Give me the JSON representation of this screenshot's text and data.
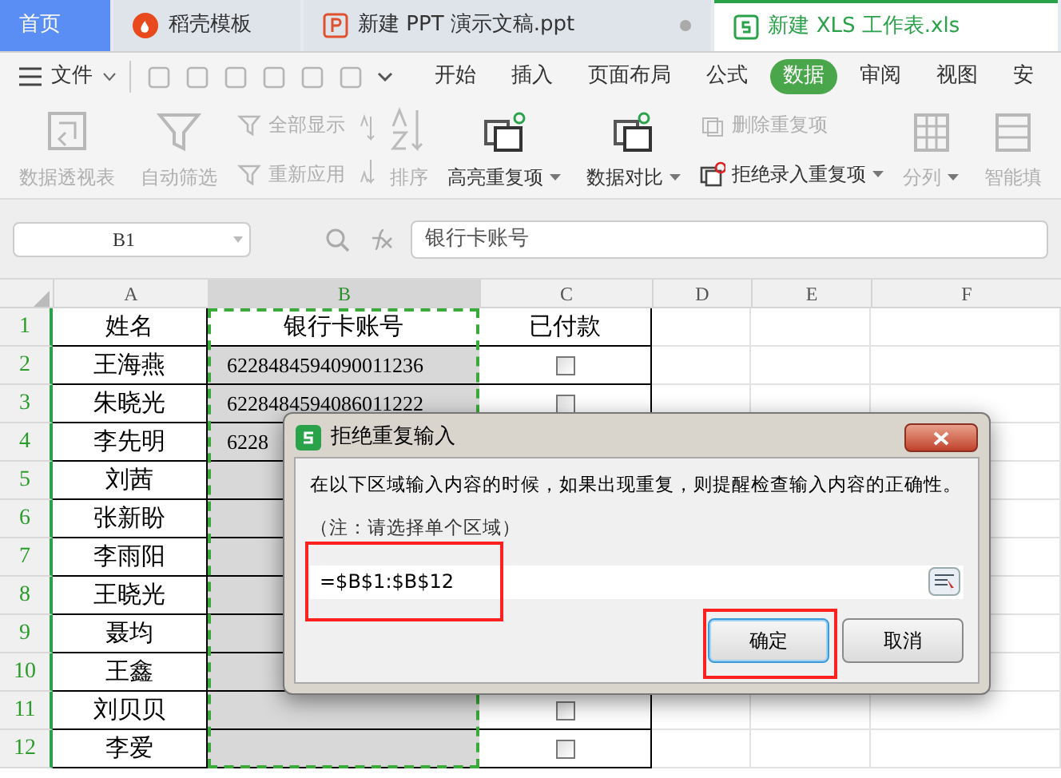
{
  "tabs": [
    {
      "kind": "home",
      "label": "首页",
      "selected": false
    },
    {
      "kind": "template",
      "label": "稻壳模板",
      "selected": false
    },
    {
      "kind": "ppt",
      "label": "新建 PPT 演示文稿.ppt",
      "selected": false
    },
    {
      "kind": "xls",
      "label": "新建 XLS 工作表.xls",
      "selected": true
    }
  ],
  "menu": {
    "file": "文件",
    "tabs": [
      {
        "label": "开始",
        "selected": false
      },
      {
        "label": "插入",
        "selected": false
      },
      {
        "label": "页面布局",
        "selected": false
      },
      {
        "label": "公式",
        "selected": false
      },
      {
        "label": "数据",
        "selected": true
      },
      {
        "label": "审阅",
        "selected": false
      },
      {
        "label": "视图",
        "selected": false
      },
      {
        "label": "安",
        "selected": false
      }
    ]
  },
  "ribbon": [
    {
      "kind": "big",
      "label": "数据透视表",
      "disabled": true,
      "dropdown": false
    },
    {
      "kind": "big",
      "label": "自动筛选",
      "disabled": true,
      "dropdown": false
    },
    {
      "kind": "stack",
      "items": [
        {
          "label": "全部显示",
          "disabled": true,
          "dropdown": false
        },
        {
          "label": "重新应用",
          "disabled": true,
          "dropdown": false
        }
      ]
    },
    {
      "kind": "sort",
      "label": "排序",
      "disabled": true
    },
    {
      "kind": "big",
      "label": "高亮重复项",
      "disabled": false,
      "dropdown": true
    },
    {
      "kind": "big",
      "label": "数据对比",
      "disabled": false,
      "dropdown": true
    },
    {
      "kind": "stack",
      "items": [
        {
          "label": "删除重复项",
          "disabled": true,
          "dropdown": false
        },
        {
          "label": "拒绝录入重复项",
          "disabled": false,
          "dropdown": true
        }
      ]
    },
    {
      "kind": "big",
      "label": "分列",
      "disabled": true,
      "dropdown": true
    },
    {
      "kind": "big",
      "label": "智能填",
      "disabled": true,
      "dropdown": false
    }
  ],
  "name_box": "B1",
  "formula": "银行卡账号",
  "columns": [
    {
      "label": "A",
      "selected": false
    },
    {
      "label": "B",
      "selected": true
    },
    {
      "label": "C",
      "selected": false
    },
    {
      "label": "D",
      "selected": false
    },
    {
      "label": "E",
      "selected": false
    },
    {
      "label": "F",
      "selected": false
    }
  ],
  "rows": [
    {
      "number": "1",
      "name": "姓名",
      "account": "银行卡账号",
      "paid_header": "已付款"
    },
    {
      "number": "2",
      "name": "王海燕",
      "account": "6228484594090011236",
      "paid": false
    },
    {
      "number": "3",
      "name": "朱晓光",
      "account": "6228484594086011222",
      "paid": false
    },
    {
      "number": "4",
      "name": "李先明",
      "account": "6228"
    },
    {
      "number": "5",
      "name": "刘茜"
    },
    {
      "number": "6",
      "name": "张新盼"
    },
    {
      "number": "7",
      "name": "李雨阳"
    },
    {
      "number": "8",
      "name": "王晓光"
    },
    {
      "number": "9",
      "name": "聂均"
    },
    {
      "number": "10",
      "name": "王鑫"
    },
    {
      "number": "11",
      "name": "刘贝贝",
      "paid": false
    },
    {
      "number": "12",
      "name": "李爱",
      "paid": false
    }
  ],
  "dialog": {
    "title": "拒绝重复输入",
    "message": "在以下区域输入内容的时候，如果出现重复，则提醒检查输入内容的正确性。",
    "note": "（注：请选择单个区域）",
    "range": {
      "value": "=$B$1:$B$12",
      "highlighted": true
    },
    "buttons": [
      {
        "label": "确定",
        "kind": "ok",
        "highlighted": true
      },
      {
        "label": "取消",
        "kind": "cancel",
        "highlighted": false
      }
    ]
  }
}
